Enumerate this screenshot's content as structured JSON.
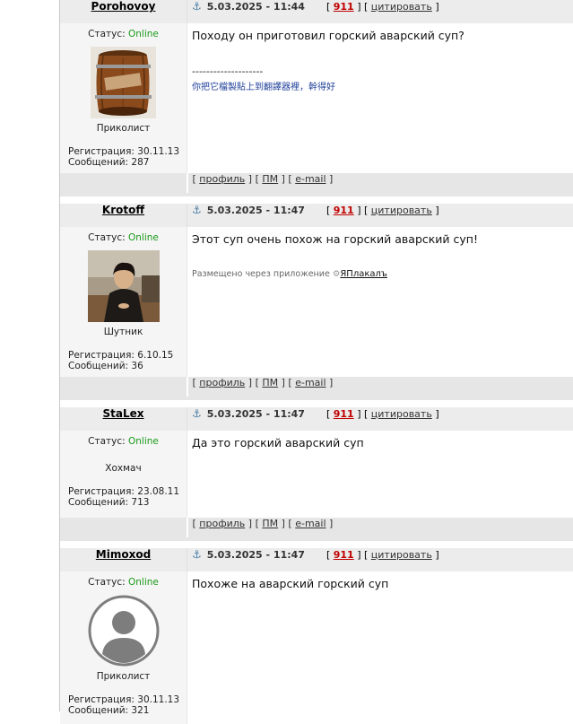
{
  "posts": [
    {
      "nick": "Porohovoy",
      "date": "5.03.2025 - 11:44",
      "number": "911",
      "quote": "цитировать",
      "status_label": "Статус:",
      "status": "Online",
      "rank": "Приколист",
      "reg": "Регистрация: 30.11.13",
      "msgs": "Сообщений: 287",
      "text": "Походу он приготовил горский аварский суп?",
      "sig_line": "--------------------",
      "sig_text": "你把它檔製貼上到翻譯器裡，幹得好",
      "avatar": "barrel-avatar"
    },
    {
      "nick": "Krotoff",
      "date": "5.03.2025 - 11:47",
      "number": "911",
      "quote": "цитировать",
      "status_label": "Статус:",
      "status": "Online",
      "rank": "Шутник",
      "reg": "Регистрация: 6.10.15",
      "msgs": "Сообщений: 36",
      "text": "Этот суп очень похож на горский аварский суп!",
      "via_prefix": "Размещено через приложение",
      "via_app": "ЯПлакалъ",
      "avatar": "man-photo-avatar"
    },
    {
      "nick": "StaLex",
      "date": "5.03.2025 - 11:47",
      "number": "911",
      "quote": "цитировать",
      "status_label": "Статус:",
      "status": "Online",
      "rank": "Хохмач",
      "reg": "Регистрация: 23.08.11",
      "msgs": "Сообщений: 713",
      "text": "Да это горский аварский суп"
    },
    {
      "nick": "Mimoxod",
      "date": "5.03.2025 - 11:47",
      "number": "911",
      "quote": "цитировать",
      "status_label": "Статус:",
      "status": "Online",
      "rank": "Приколист",
      "reg": "Регистрация: 30.11.13",
      "msgs": "Сообщений: 321",
      "text": "Похоже на аварский горский суп",
      "avatar": "default-user-avatar"
    }
  ],
  "footer": {
    "profile": "профиль",
    "pm": "ПМ",
    "email": "e-mail"
  },
  "colors": {
    "online": "#1a9a1a",
    "number": "#c00000",
    "header_bg": "#ececec"
  }
}
